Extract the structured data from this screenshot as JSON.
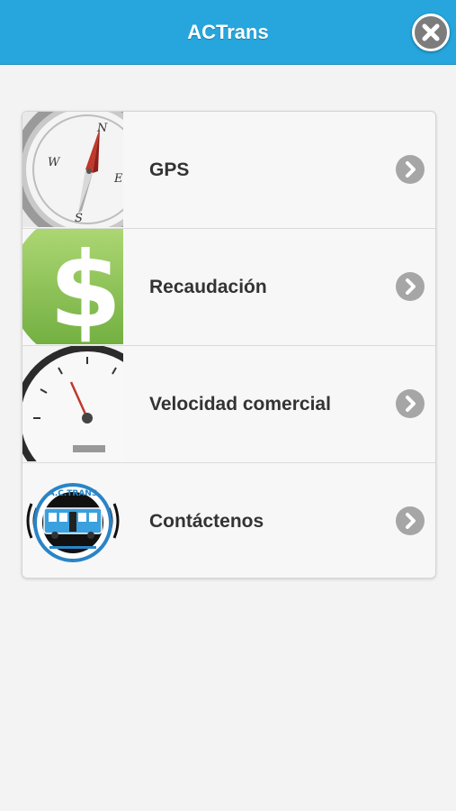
{
  "header": {
    "title": "ACTrans",
    "close_icon": "close-icon"
  },
  "menu": {
    "items": [
      {
        "label": "GPS",
        "icon": "compass-icon"
      },
      {
        "label": "Recaudación",
        "icon": "dollar-icon"
      },
      {
        "label": "Velocidad comercial",
        "icon": "speedometer-icon"
      },
      {
        "label": "Contáctenos",
        "icon": "actrans-logo-icon",
        "logo_text": "A.C.TRANS"
      }
    ],
    "arrow_icon": "chevron-right-icon"
  },
  "colors": {
    "header_bg": "#26a6dd",
    "background": "#f3f3f3",
    "chevron": "#a6a6a6",
    "label_text": "#333333"
  }
}
